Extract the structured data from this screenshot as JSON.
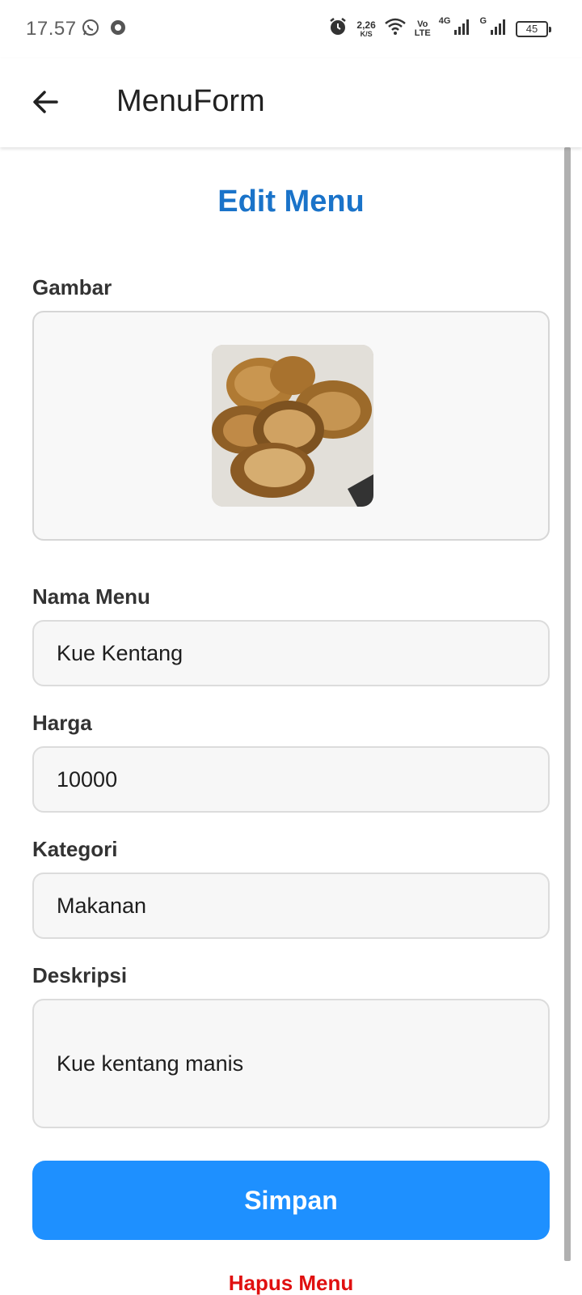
{
  "status_bar": {
    "time": "17.57",
    "left_icons": [
      "whatsapp-icon",
      "record-icon"
    ],
    "net_speed_value": "2,26",
    "net_speed_unit": "K/S",
    "volte_top": "Vo",
    "volte_bottom": "LTE",
    "sim1_label": "4G",
    "sim2_label": "G",
    "battery": "45"
  },
  "app_bar": {
    "title": "MenuForm"
  },
  "form": {
    "heading": "Edit Menu",
    "image_label": "Gambar",
    "name_label": "Nama Menu",
    "name_value": "Kue Kentang",
    "price_label": "Harga",
    "price_value": "10000",
    "category_label": "Kategori",
    "category_value": "Makanan",
    "description_label": "Deskripsi",
    "description_value": "Kue kentang manis",
    "save_label": "Simpan",
    "delete_label": "Hapus Menu"
  },
  "colors": {
    "heading": "#1a73c9",
    "primary_button": "#1e90ff",
    "danger_text": "#e01010"
  }
}
